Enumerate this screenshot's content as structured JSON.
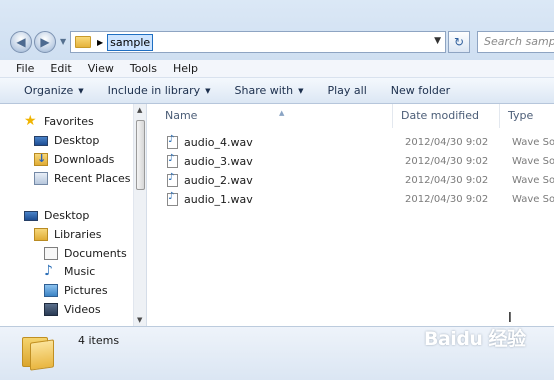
{
  "address_bar": {
    "path_segment": "sample",
    "search_placeholder": "Search sample"
  },
  "menu": [
    "File",
    "Edit",
    "View",
    "Tools",
    "Help"
  ],
  "toolbar": {
    "organize": "Organize",
    "include_in_library": "Include in library",
    "share_with": "Share with",
    "play_all": "Play all",
    "new_folder": "New folder"
  },
  "nav_pane": {
    "favorites": "Favorites",
    "desktop_fav": "Desktop",
    "downloads": "Downloads",
    "recent_places": "Recent Places",
    "desktop": "Desktop",
    "libraries": "Libraries",
    "documents": "Documents",
    "music": "Music",
    "pictures": "Pictures",
    "videos": "Videos"
  },
  "file_list": {
    "columns": {
      "name": "Name",
      "date_modified": "Date modified",
      "type": "Type"
    },
    "files": [
      {
        "name": "audio_4.wav",
        "date": "2012/04/30 9:02",
        "type": "Wave Sound"
      },
      {
        "name": "audio_3.wav",
        "date": "2012/04/30 9:02",
        "type": "Wave Sound"
      },
      {
        "name": "audio_2.wav",
        "date": "2012/04/30 9:02",
        "type": "Wave Sound"
      },
      {
        "name": "audio_1.wav",
        "date": "2012/04/30 9:02",
        "type": "Wave Sound"
      }
    ]
  },
  "details_pane": {
    "item_count": "4 items"
  },
  "watermark": "Baidu 经验"
}
